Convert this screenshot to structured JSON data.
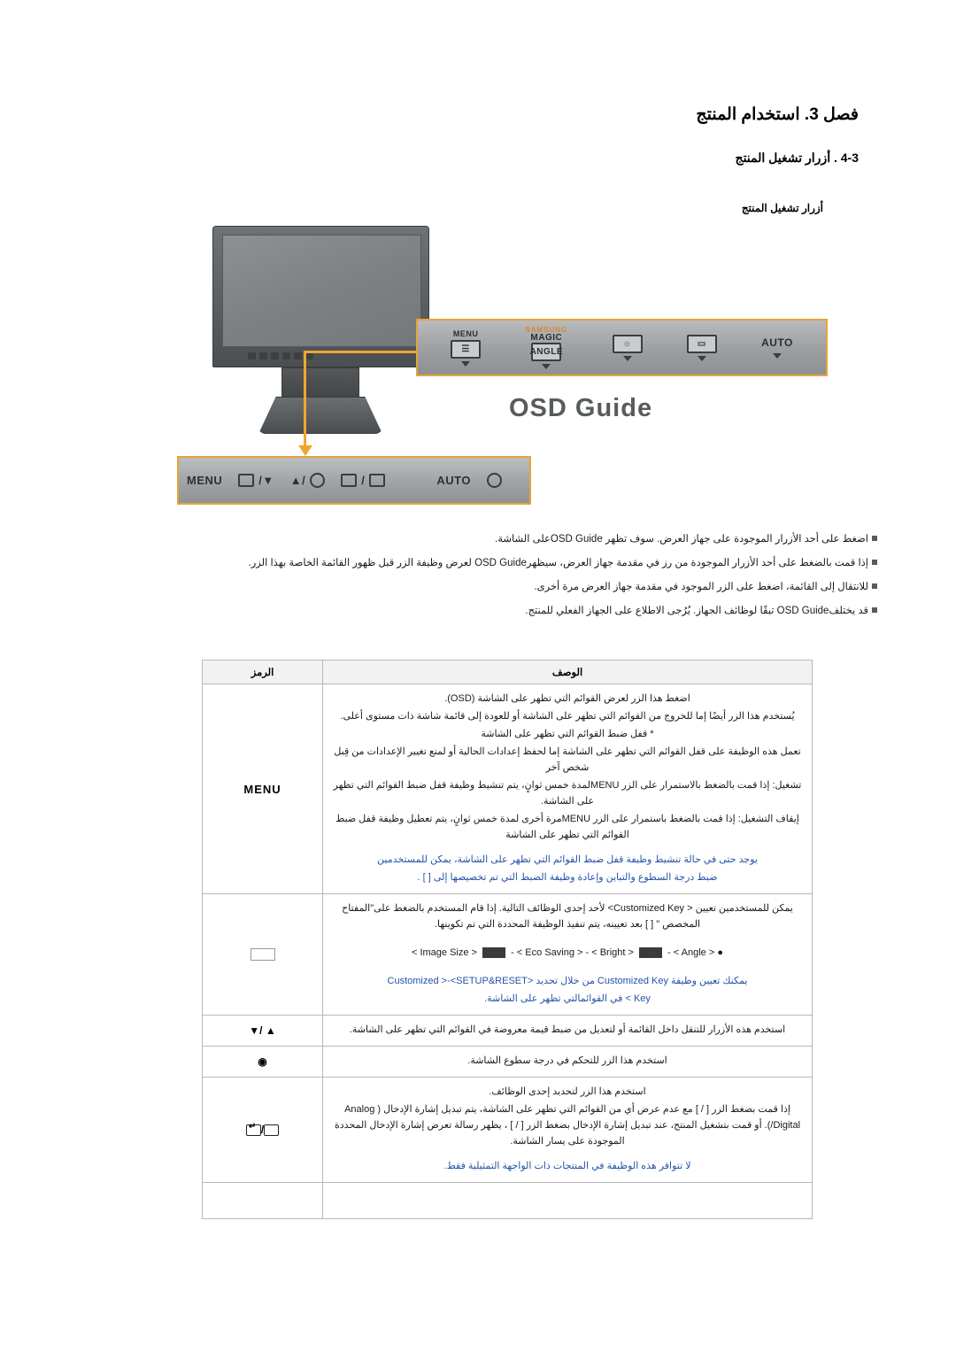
{
  "headings": {
    "main": "فصل 3. استخدام المنتج",
    "sub": "4-3 . أزرار تشغيل المنتج",
    "sub2": "أزرار تشغيل المنتج"
  },
  "figure": {
    "osd_guide_label": "OSD Guide",
    "panel_buttons": [
      {
        "label": "MENU",
        "glyph": "☰"
      },
      {
        "label": "MAGIC",
        "brand": "SAMSUNG",
        "sub": "ANGLE"
      },
      {
        "label": "",
        "glyph": "☀"
      },
      {
        "label": "",
        "glyph": "▭"
      },
      {
        "label": "AUTO",
        "glyph": ""
      }
    ],
    "bottom_bar": {
      "menu": "MENU",
      "item2": "/▼",
      "item3": "▲/",
      "item4": "/",
      "auto": "AUTO"
    }
  },
  "bullets": [
    "اضغط على أحد الأزرار الموجودة على جهاز العرض. سوف تظهر OSD Guideعلى الشاشة.",
    "إذا قمت بالضغط على أحد الأزرار الموجودة من رز في مقدمة جهاز العرض، سيظهرOSD Guide لعرض وظيفة الزر قبل ظهور القائمة الخاصة بهذا الزر.",
    "للانتقال إلى القائمة، اضغط على الزر الموجود في مقدمة جهاز العرض مرة أخرى.",
    "قد يختلفOSD Guide تبقًا لوظائف الجهاز. يُرُجى الاطلاع على الجهاز الفعلي للمنتج."
  ],
  "table": {
    "headers": {
      "description": "الوصف",
      "symbol": "الرمز"
    },
    "rows": [
      {
        "symbol": "MENU",
        "symbol_class": "sym-small",
        "lines": [
          {
            "text": "اضغط هذا الزر لعرض القوائم التي تظهر على الشاشة (OSD).",
            "style": "plain"
          },
          {
            "text": "يُستخدم هذا الزر أيضًا إما للخروج من القوائم التي تظهر على الشاشة أو للعودة إلى قائمة شاشة ذات مستوى أعلى.",
            "style": "plain"
          },
          {
            "text": "* قفل ضبط القوائم التي تظهر على الشاشة",
            "style": "plain"
          },
          {
            "text": "تعمل هذه الوظيفة على قفل القوائم التي تظهر على الشاشة إما لحفظ إعدادات الحالية أو لمنع تغيير الإعدادات من قِبل شخص آخر",
            "style": "plain"
          },
          {
            "text": "تشغيل: إذا قمت بالضغط بالاستمرار على الزر MENUلمدة خمس ثوانٍ، يتم تنشيط وظيفة قفل ضبط القوائم التي تظهر على الشاشة.",
            "style": "plain"
          },
          {
            "text": "إيقاف التشغيل: إذا قمت بالضغط باستمرار على الزر MENUمرة أخرى لمدة خمس ثوانٍ، يتم تعطيل وظيفة قفل ضبط القوائم التي تظهر على الشاشة",
            "style": "plain"
          },
          {
            "text": "يوجد حتى في حالة تنشيط وظيفة قفل ضبط القوائم التي تظهر على الشاشة، يمكن للمستخدمين",
            "style": "blue"
          },
          {
            "text": "ضبط درجة السطوع والتباين وإعادة وظيفة الضبط التي تم تخصيصها إلى [      ] .",
            "style": "blue"
          }
        ]
      },
      {
        "symbol": "",
        "lines": [
          {
            "text": "يمكن للمستخدمين تعيين <  Customized Key> لأحد إحدى الوظائف التالية. إذا قام المستخدم بالضغط على\"المفتاح المخصص \" [     ] بعد تعيينه، يتم تنفيذ الوظيفة المحددة التي تم تكوينها.",
            "style": "plain"
          },
          {
            "text": "SPECIAL_ROW",
            "style": "special"
          },
          {
            "text": "يمكنك تعيين وظيفة Customized Key من خلال تحديد <Customized  >-<SETUP&RESET",
            "style": "blue"
          },
          {
            "text": "Key > في القوائمالتي تظهر على الشاشة.",
            "style": "blue"
          }
        ],
        "special_items": [
          "●",
          "<  Image Size  >",
          "-",
          "<  Eco Saving  >",
          "-",
          "<  Bright  >",
          "-",
          "<  Angle  >"
        ]
      },
      {
        "symbol": "▲ /▼",
        "lines": [
          {
            "text": "استخدم هذه الأزرار للتنقل داخل القائمة أو لتعديل من ضبط قيمة معروضة في القوائم التي تظهر على الشاشة.",
            "style": "plain"
          }
        ]
      },
      {
        "symbol": "◉",
        "lines": [
          {
            "text": "استخدم هذا الزر للتحكم في درجة سطوع الشاشة.",
            "style": "plain"
          }
        ]
      },
      {
        "symbol": "ICON_ENTER",
        "lines": [
          {
            "text": "استخدم هذا الزر لتحديد إحدى الوظائف.",
            "style": "plain"
          },
          {
            "text": "إذا قمت بضغط الزر [     /     ] مع عدم عرض أي من القوائم التي تظهر على الشاشة، يتم تبديل إشارة الإدخال ( Analog /Digital). أو قمت بتشغيل المنتج، عند تبديل إشارة الإدخال بضغط الزر [     /     ] ، يظهر رسالة تعرض إشارة الإدخال المحددة الموجودة على يسار الشاشة.",
            "style": "plain"
          },
          {
            "text": "لا تتوافر هذه الوظيفة في المنتجات ذات الواجهة التمثيلية فقط.",
            "style": "blue"
          }
        ]
      },
      {
        "symbol": "",
        "lines": []
      }
    ]
  },
  "colors": {
    "accent_orange": "#e8a33a",
    "blue_note": "#2453a6",
    "table_border": "#b8b8b8",
    "header_bg": "#f2f2f2"
  }
}
